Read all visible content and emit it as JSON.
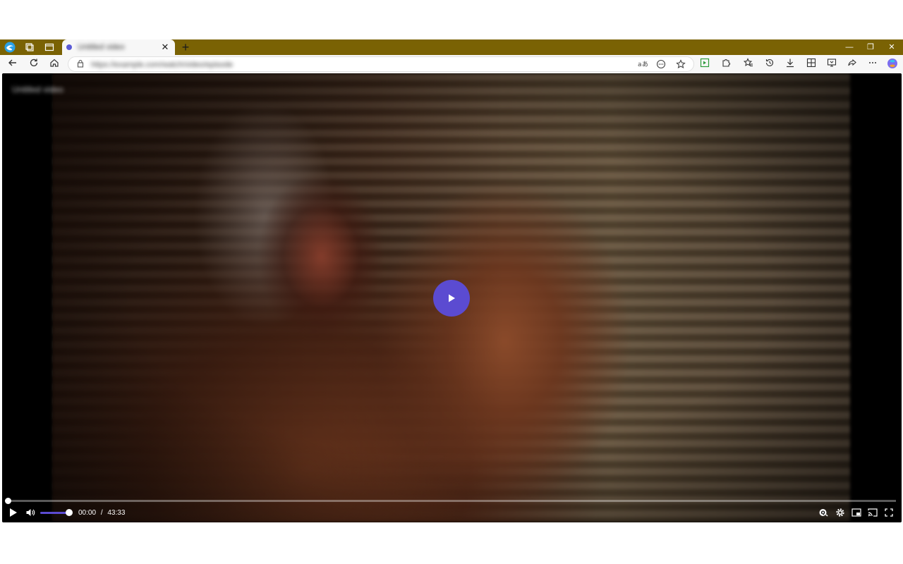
{
  "browser": {
    "tab": {
      "title": "Untitled video"
    },
    "newtab_label": "+",
    "window": {
      "minimize": "—",
      "restore": "❐",
      "close": "✕"
    },
    "address": {
      "url": "https://example.com/watch/video/episode",
      "placeholder": ""
    },
    "toolbar_icons": [
      "translate-icon",
      "reader-icon",
      "favorite-icon",
      "split-screen-icon",
      "extensions-icon",
      "favorites-icon",
      "history-icon",
      "downloads-icon",
      "collections-icon",
      "screenshot-icon",
      "share-icon",
      "more-icon",
      "copilot-icon"
    ],
    "accent": "#7a6204"
  },
  "player": {
    "title": "Untitled video",
    "current_time": "00:00",
    "separator": "/",
    "duration": "43:33",
    "volume_level": 1.0,
    "progress_fraction": 0.0,
    "accent": "#5b4bd1"
  }
}
